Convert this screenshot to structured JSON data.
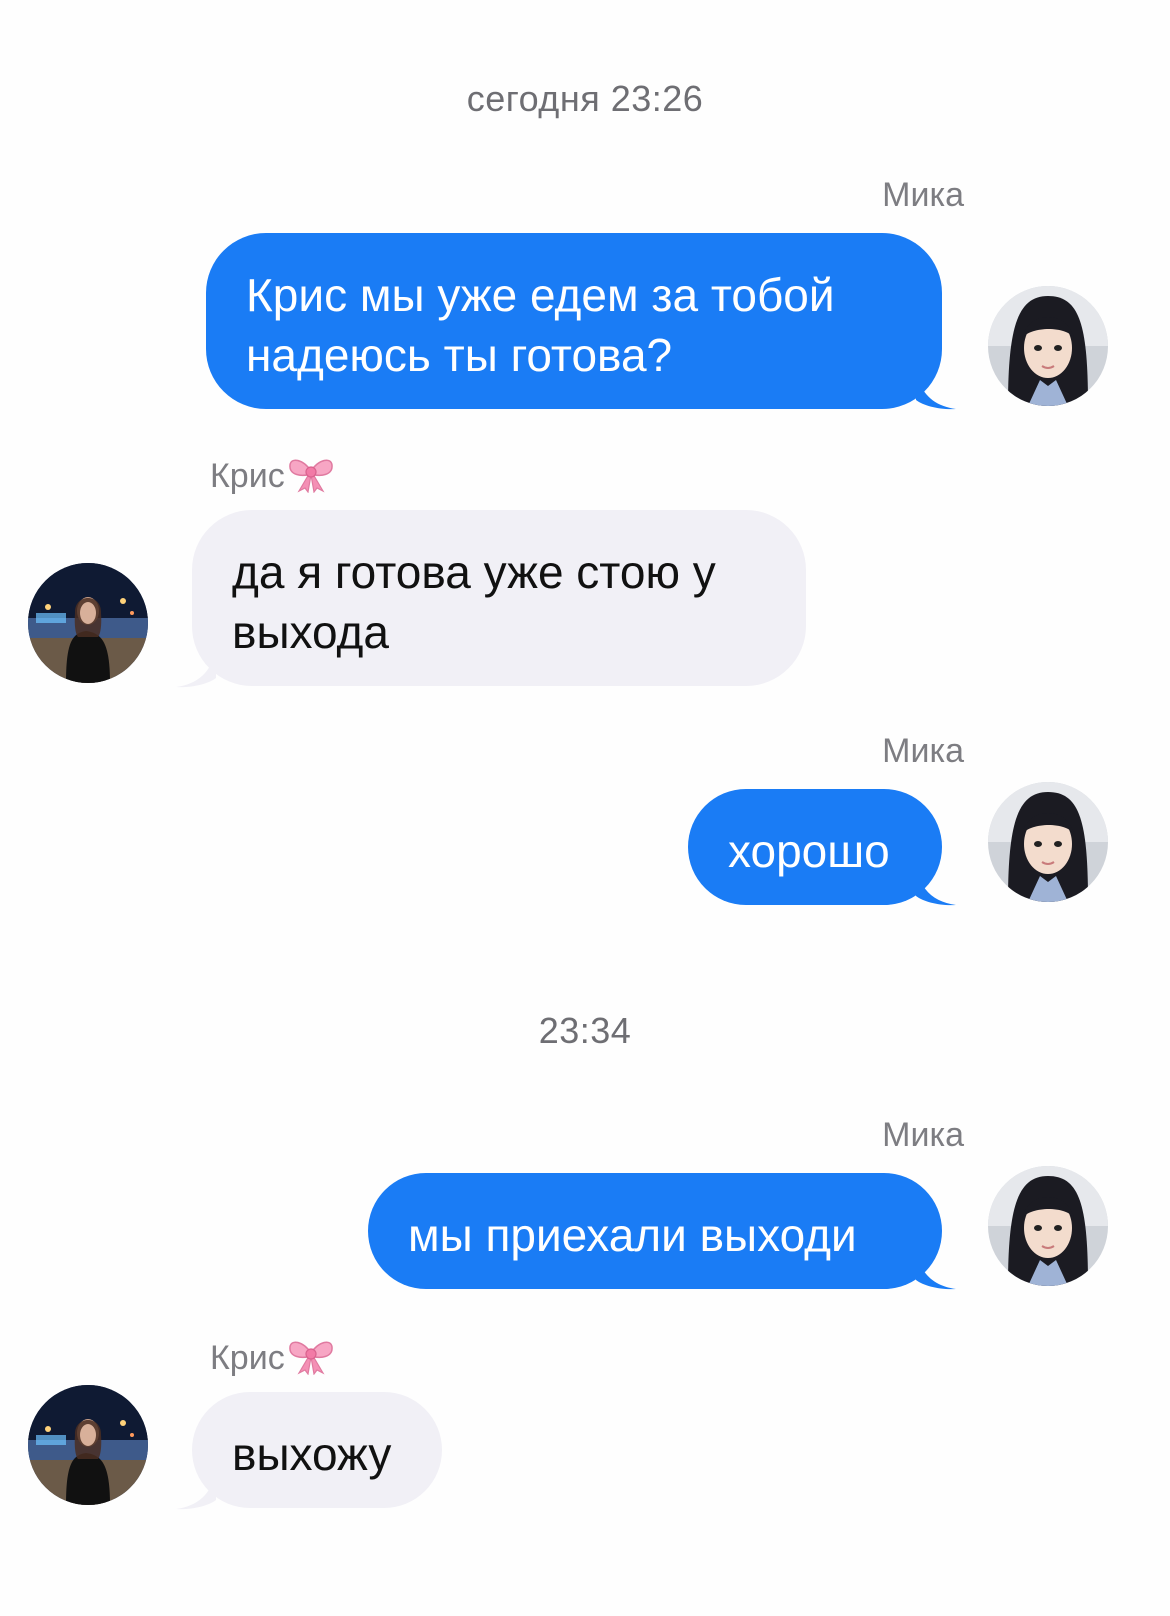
{
  "timestamps": {
    "first": "сегодня 23:26",
    "second": "23:34"
  },
  "messages": [
    {
      "sender": "Мика",
      "text": "Крис мы уже едем за тобой надеюсь ты готова?",
      "side": "outgoing",
      "avatar": "mika-avatar"
    },
    {
      "sender": "Крис",
      "sender_emoji": "ribbon-bow-icon",
      "text": "да я готова уже стою у выхода",
      "side": "incoming",
      "avatar": "kris-avatar"
    },
    {
      "sender": "Мика",
      "text": "хорошо",
      "side": "outgoing",
      "avatar": "mika-avatar"
    },
    {
      "sender": "Мика",
      "text": "мы приехали выходи",
      "side": "outgoing",
      "avatar": "mika-avatar"
    },
    {
      "sender": "Крис",
      "sender_emoji": "ribbon-bow-icon",
      "text": "выхожу",
      "side": "incoming",
      "avatar": "kris-avatar"
    }
  ],
  "colors": {
    "outgoing_bubble": "#1a7cf5",
    "incoming_bubble": "#f1f0f6",
    "timestamp": "#6e6e73",
    "sender": "#7d7d82"
  }
}
